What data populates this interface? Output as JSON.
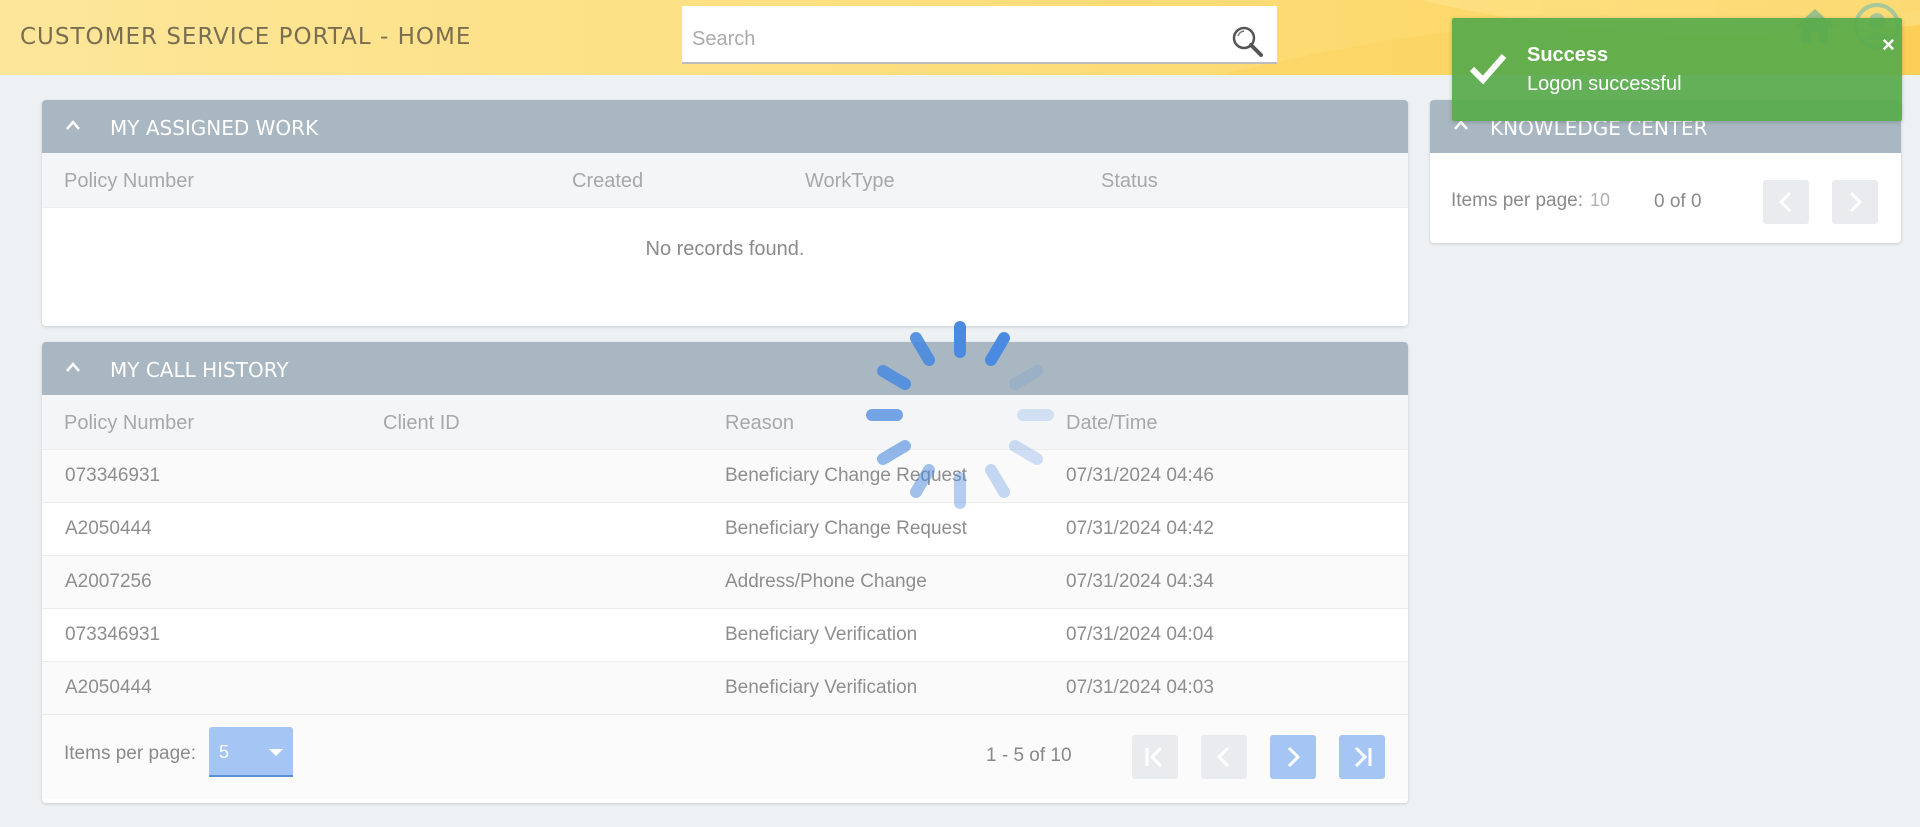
{
  "header": {
    "title": "CUSTOMER SERVICE PORTAL - HOME",
    "search_placeholder": "Search",
    "search_value": "",
    "home_icon": "home-icon",
    "user_icon": "user-icon"
  },
  "assigned_work": {
    "title": "MY ASSIGNED WORK",
    "columns": [
      "Policy Number",
      "Created",
      "WorkType",
      "Status"
    ],
    "empty_message": "No records found."
  },
  "call_history": {
    "title": "MY CALL HISTORY",
    "columns": [
      "Policy Number",
      "Client ID",
      "Reason",
      "Date/Time"
    ],
    "rows": [
      {
        "policy": "073346931",
        "client_id": "",
        "reason": "Beneficiary Change Request",
        "datetime": "07/31/2024 04:46"
      },
      {
        "policy": "A2050444",
        "client_id": "",
        "reason": "Beneficiary Change Request",
        "datetime": "07/31/2024 04:42"
      },
      {
        "policy": "A2007256",
        "client_id": "",
        "reason": "Address/Phone Change",
        "datetime": "07/31/2024 04:34"
      },
      {
        "policy": "073346931",
        "client_id": "",
        "reason": "Beneficiary Verification",
        "datetime": "07/31/2024 04:04"
      },
      {
        "policy": "A2050444",
        "client_id": "",
        "reason": "Beneficiary Verification",
        "datetime": "07/31/2024 04:03"
      }
    ],
    "pager": {
      "items_per_page_label": "Items per page:",
      "items_per_page_value": "5",
      "range": "1 - 5 of 10"
    }
  },
  "knowledge_center": {
    "title": "KNOWLEDGE CENTER",
    "pager": {
      "items_per_page_label": "Items per page:",
      "items_per_page_value": "10",
      "range": "0 of 0"
    }
  },
  "toast": {
    "title": "Success",
    "message": "Logon successful",
    "close_glyph": "×"
  },
  "colors": {
    "header_yellow": "#fde082",
    "panel_header": "#a8b7c1",
    "accent_blue": "#a5c6f4",
    "spinner_blue": "#4a8ae0",
    "toast_green": "#58aa4b"
  }
}
